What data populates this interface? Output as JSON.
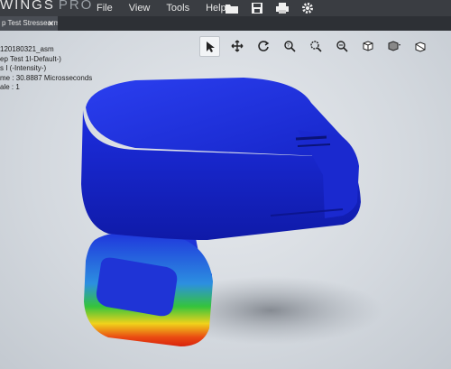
{
  "app": {
    "brand": "WINGS",
    "brand_suffix": "PRO"
  },
  "menu": [
    "File",
    "View",
    "Tools",
    "Help"
  ],
  "quick_tools": [
    "open-folder-icon",
    "save-icon",
    "print-icon",
    "gear-icon"
  ],
  "document_tab": {
    "label": "p Test Stressearm"
  },
  "result_info": {
    "lines": [
      "120180321_asm",
      "ep Test 1I-Default-)",
      "s I (-Intensity-)",
      "me : 30.8887 Microsseconds",
      "ale : 1"
    ]
  },
  "view_tools": [
    "select-arrow-icon",
    "move-icon",
    "rotate-icon",
    "zoom-fit-icon",
    "zoom-window-icon",
    "zoom-icon",
    "view-cube-icon",
    "display-style-icon",
    "section-view-icon"
  ],
  "colors": {
    "body_blue": "#1f2fd6",
    "hot_red": "#e02b0e",
    "mid_yellow": "#f2d21a",
    "green": "#2fbf3a"
  }
}
